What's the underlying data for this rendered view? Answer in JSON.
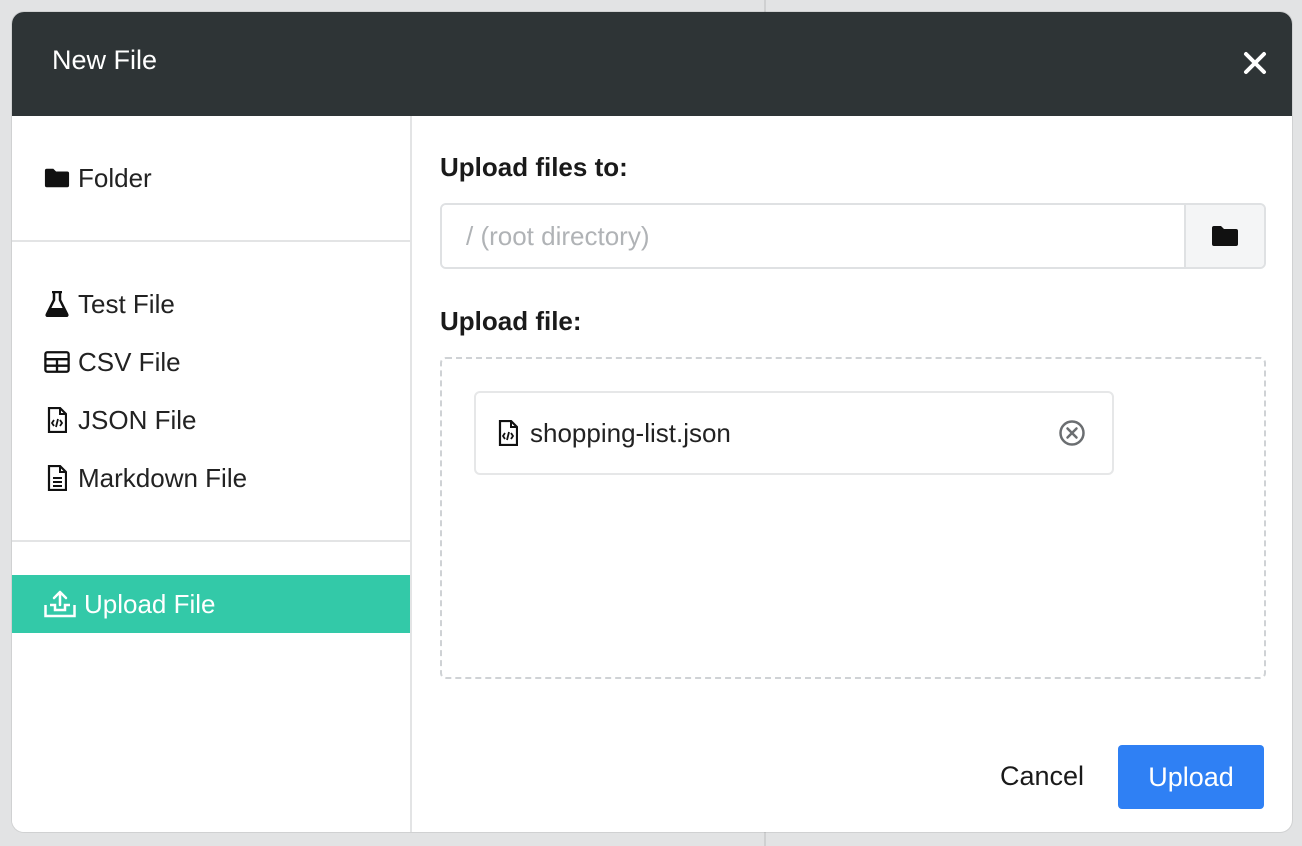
{
  "modal": {
    "title": "New File"
  },
  "sidebar": {
    "groups": [
      {
        "items": [
          {
            "label": "Folder",
            "icon": "folder-icon"
          }
        ]
      },
      {
        "items": [
          {
            "label": "Test File",
            "icon": "flask-icon"
          },
          {
            "label": "CSV File",
            "icon": "table-icon"
          },
          {
            "label": "JSON File",
            "icon": "file-code-icon"
          },
          {
            "label": "Markdown File",
            "icon": "file-text-icon"
          }
        ]
      },
      {
        "items": [
          {
            "label": "Upload File",
            "icon": "upload-icon",
            "active": true
          }
        ]
      }
    ],
    "active_color": "#33c9a8"
  },
  "form": {
    "destination_label": "Upload files to:",
    "destination_placeholder": "/ (root directory)",
    "file_label": "Upload file:",
    "files": [
      {
        "name": "shopping-list.json",
        "icon": "file-code-icon"
      }
    ]
  },
  "actions": {
    "cancel_label": "Cancel",
    "upload_label": "Upload",
    "upload_color": "#2f80f4"
  },
  "colors": {
    "header_bg": "#2e3436"
  }
}
